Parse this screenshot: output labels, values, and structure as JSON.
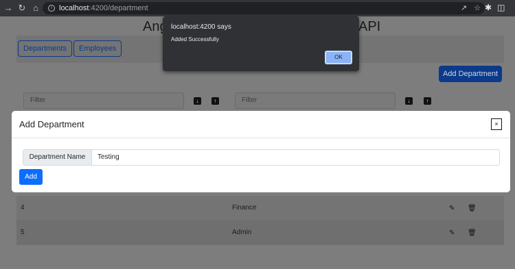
{
  "browser": {
    "host": "localhost",
    "path": ":4200/department"
  },
  "page": {
    "title_left": "Ang",
    "title_right": "API",
    "nav": [
      "Departments",
      "Employees"
    ],
    "add_department_label": "Add Department",
    "filter_placeholder": "Filter"
  },
  "table": {
    "rows": [
      {
        "id": "4",
        "name": "Finance"
      },
      {
        "id": "5",
        "name": "Admin"
      }
    ]
  },
  "modal": {
    "title": "Add Department",
    "close_label": "×",
    "field_label": "Department Name",
    "field_value": "Testing",
    "add_label": "Add"
  },
  "alert": {
    "title": "localhost:4200 says",
    "message": "Added Successfully",
    "ok_label": "OK"
  },
  "colors": {
    "primary": "#0d6efd",
    "alert_bg": "#303134",
    "ok_button": "#8ab4f8"
  }
}
